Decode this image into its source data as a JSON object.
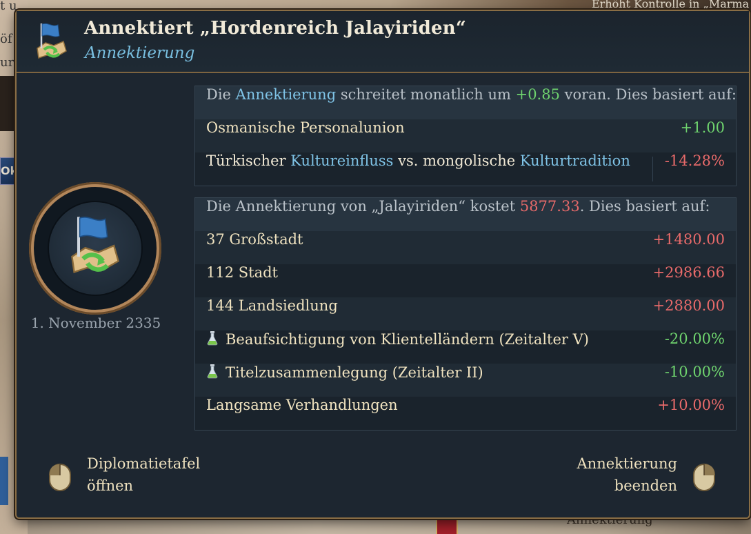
{
  "background": {
    "top_right_text": "Erhöht Kontrolle in „Marma",
    "left_button": "Ok",
    "bottom_text": "Annektierung",
    "left_fragments": [
      "t u",
      "öf",
      "ur"
    ]
  },
  "header": {
    "title": "Annektiert „Hordenreich Jalayiriden“",
    "subtitle": "Annektierung",
    "icon": "annex-flag-icon"
  },
  "date": "1. November 2335",
  "progress_table": {
    "intro_prefix": "Die ",
    "intro_term": "Annektierung",
    "intro_mid": " schreitet monatlich um ",
    "intro_value": "+0.85",
    "intro_suffix": " voran. Dies basiert auf:",
    "rows": [
      {
        "label": "Osmanische Personalunion",
        "value": "+1.00"
      },
      {
        "label_a": "Türkischer ",
        "label_b": "Kultureinfluss",
        "label_c": " vs. mongolische ",
        "label_d": "Kulturtradition",
        "value": "-14.28%"
      }
    ]
  },
  "cost_table": {
    "intro_prefix": "Die Annektierung von „Jalayiriden“ kostet ",
    "intro_value": "5877.33",
    "intro_suffix": ". Dies basiert auf:",
    "rows": [
      {
        "label": "37 Großstadt",
        "value": "+1480.00"
      },
      {
        "label": "112 Stadt",
        "value": "+2986.66"
      },
      {
        "label": "144 Landsiedlung",
        "value": "+2880.00"
      },
      {
        "label": "Beaufsichtigung von Klientelländern (Zeitalter V)",
        "value": "-20.00%",
        "icon": "flask-icon"
      },
      {
        "label": "Titelzusammenlegung (Zeitalter II)",
        "value": "-10.00%",
        "icon": "flask-icon"
      },
      {
        "label": "Langsame Verhandlungen",
        "value": "+10.00%"
      }
    ]
  },
  "actions": {
    "left_line1": "Diplomatietafel",
    "left_line2": "öffnen",
    "right_line1": "Annektierung",
    "right_line2": "beenden"
  },
  "colors": {
    "panel_bg": "#1d2630",
    "border_gold": "#8a6e45",
    "keyword_blue": "#7fc3e6",
    "positive_green": "#6fd46e",
    "negative_red": "#e86a6a",
    "text_cream": "#f0e3c0"
  }
}
